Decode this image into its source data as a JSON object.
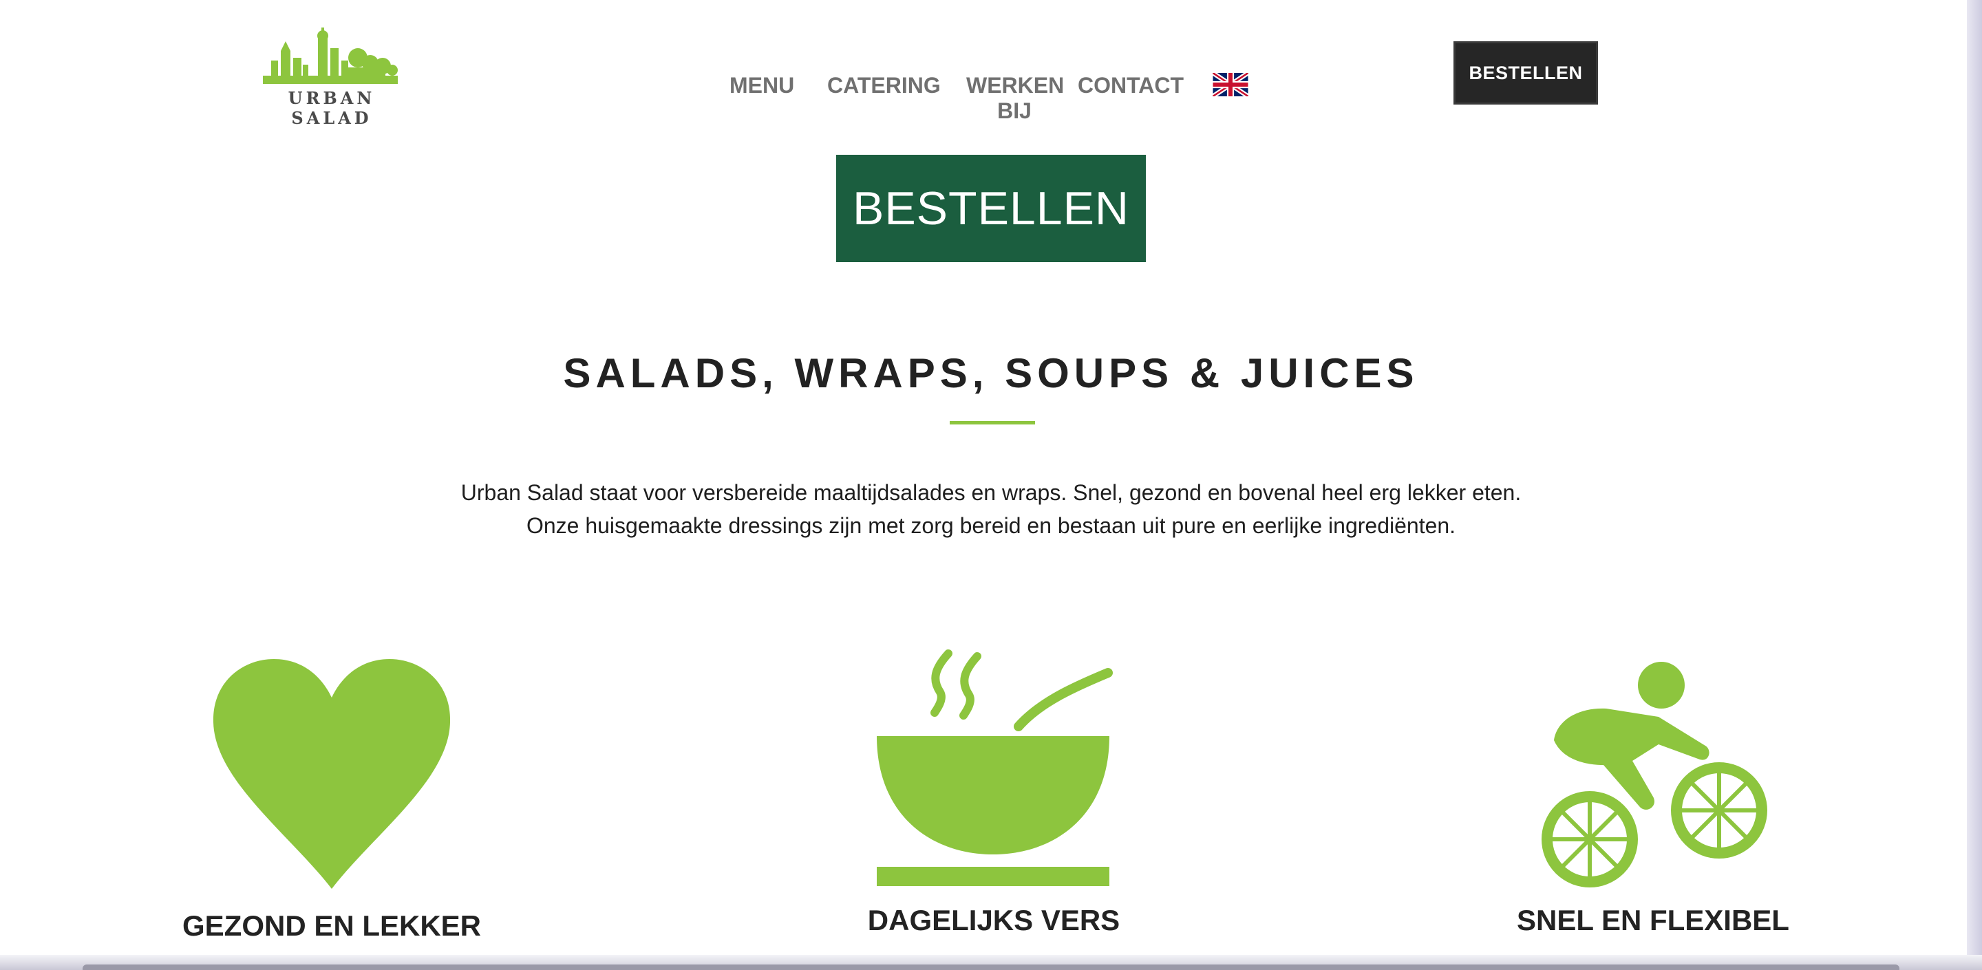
{
  "brand": {
    "logo_text": "URBAN SALAD",
    "accent_color": "#8dc53e",
    "dark_green": "#1b5e3f"
  },
  "nav": {
    "items": [
      {
        "label": "MENU"
      },
      {
        "label": "CATERING"
      },
      {
        "label": "WERKEN BIJ"
      },
      {
        "label": "CONTACT"
      }
    ],
    "language_icon": "uk-flag-icon"
  },
  "header": {
    "order_button": "BESTELLEN"
  },
  "hero": {
    "order_button": "BESTELLEN",
    "headline": "SALADS, WRAPS, SOUPS & JUICES",
    "intro_line1": "Urban Salad staat voor versbereide maaltijdsalades en wraps. Snel, gezond en bovenal heel erg lekker eten.",
    "intro_line2": "Onze huisgemaakte dressings zijn met zorg bereid en bestaan uit pure en eerlijke ingrediënten."
  },
  "features": [
    {
      "icon": "heart-icon",
      "title": "GEZOND EN LEKKER"
    },
    {
      "icon": "soup-bowl-icon",
      "title": "DAGELIJKS VERS"
    },
    {
      "icon": "cyclist-icon",
      "title": "SNEL EN FLEXIBEL"
    }
  ]
}
